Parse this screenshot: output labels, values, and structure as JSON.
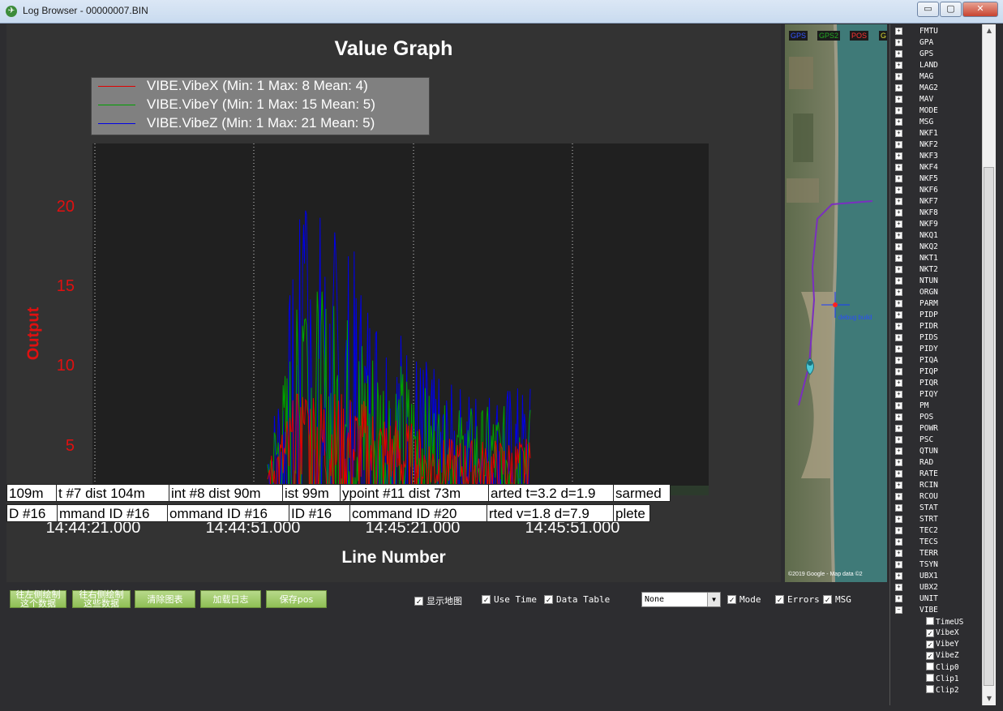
{
  "window": {
    "title": "Log Browser - 00000007.BIN",
    "min": "▭",
    "restore": "▢",
    "close": "✕"
  },
  "graph": {
    "title": "Value Graph",
    "ylabel": "Output",
    "xlabel": "Line Number",
    "legend": [
      {
        "label": "VIBE.VibeX (Min: 1 Max: 8 Mean: 4)",
        "color": "#e00000"
      },
      {
        "label": "VIBE.VibeY (Min: 1 Max: 15 Mean: 5)",
        "color": "#00a000"
      },
      {
        "label": "VIBE.VibeZ (Min: 1 Max: 21 Mean: 5)",
        "color": "#0000e6"
      }
    ],
    "yticks": [
      "20",
      "15",
      "10",
      "5"
    ],
    "xticks": [
      "14:44:21.000",
      "14:44:51.000",
      "14:45:21.000",
      "14:45:51.000"
    ],
    "annotations_row1": [
      "109m",
      "t #7 dist 104m",
      "int #8 dist 90m",
      "ist 99m",
      "ypoint #11 dist 73m",
      "arted t=3.2 d=1.9",
      "sarmed"
    ],
    "annotations_row2": [
      "D #16",
      "mmand ID #16",
      "ommand ID #16",
      "ID #16",
      "command ID #20",
      "rted v=1.8 d=7.9",
      "plete"
    ]
  },
  "chart_data": {
    "type": "line",
    "title": "Value Graph",
    "xlabel": "Line Number",
    "ylabel": "Output",
    "ylim": [
      0,
      24
    ],
    "x_ticks": [
      "14:44:21.000",
      "14:44:51.000",
      "14:45:21.000",
      "14:45:51.000"
    ],
    "series": [
      {
        "name": "VIBE.VibeX",
        "color": "#e00000",
        "min": 1,
        "max": 8,
        "mean": 4
      },
      {
        "name": "VIBE.VibeY",
        "color": "#00a000",
        "min": 1,
        "max": 15,
        "mean": 5
      },
      {
        "name": "VIBE.VibeZ",
        "color": "#0000e6",
        "min": 1,
        "max": 21,
        "mean": 5
      }
    ]
  },
  "map": {
    "chips": [
      "GPS",
      "GPS2",
      "POS",
      "G"
    ],
    "chip_colors": [
      "#3355ff",
      "#22aa22",
      "#ff3333",
      "#dddd33"
    ],
    "label": "debug build",
    "attribution": "©2019 Google - Map data ©2"
  },
  "controls": {
    "buttons": [
      "往左侧绘制\n这个数据",
      "往右侧绘制\n这些数据",
      "清除图表",
      "加载日志",
      "保存pos"
    ],
    "show_map": "显示地图",
    "use_time": "Use Time",
    "data_table": "Data Table",
    "select_value": "None",
    "mode": "Mode",
    "errors": "Errors",
    "msg": "MSG"
  },
  "tree": {
    "items": [
      "FMTU",
      "GPA",
      "GPS",
      "LAND",
      "MAG",
      "MAG2",
      "MAV",
      "MODE",
      "MSG",
      "NKF1",
      "NKF2",
      "NKF3",
      "NKF4",
      "NKF5",
      "NKF6",
      "NKF7",
      "NKF8",
      "NKF9",
      "NKQ1",
      "NKQ2",
      "NKT1",
      "NKT2",
      "NTUN",
      "ORGN",
      "PARM",
      "PIDP",
      "PIDR",
      "PIDS",
      "PIDY",
      "PIQA",
      "PIQP",
      "PIQR",
      "PIQY",
      "PM",
      "POS",
      "POWR",
      "PSC",
      "QTUN",
      "RAD",
      "RATE",
      "RCIN",
      "RCOU",
      "STAT",
      "STRT",
      "TEC2",
      "TECS",
      "TERR",
      "TSYN",
      "UBX1",
      "UBX2",
      "UNIT",
      "VIBE"
    ],
    "children": [
      {
        "label": "TimeUS",
        "checked": false
      },
      {
        "label": "VibeX",
        "checked": true
      },
      {
        "label": "VibeY",
        "checked": true
      },
      {
        "label": "VibeZ",
        "checked": true
      },
      {
        "label": "Clip0",
        "checked": false
      },
      {
        "label": "Clip1",
        "checked": false
      },
      {
        "label": "Clip2",
        "checked": false
      }
    ]
  }
}
